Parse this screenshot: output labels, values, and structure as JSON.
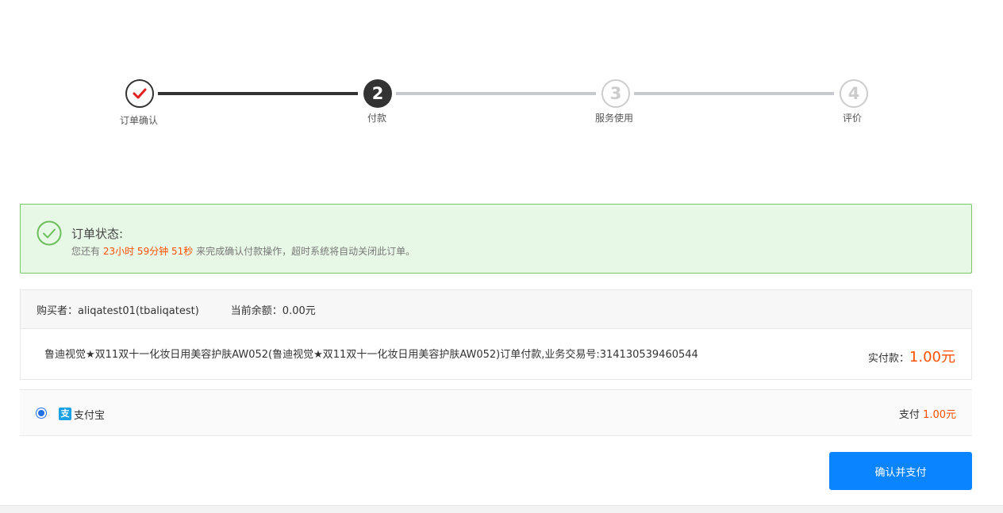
{
  "steps": {
    "items": [
      {
        "number": "",
        "label": "订单确认",
        "state": "done"
      },
      {
        "number": "2",
        "label": "付款",
        "state": "current"
      },
      {
        "number": "3",
        "label": "服务使用",
        "state": "pending"
      },
      {
        "number": "4",
        "label": "评价",
        "state": "pending"
      }
    ]
  },
  "status": {
    "title": "订单状态:",
    "msg_prefix": "您还有",
    "countdown": "23小时 59分钟 51秒",
    "msg_suffix": "来完成确认付款操作，超时系统将自动关闭此订单。",
    "icon": "check-circle-icon"
  },
  "order": {
    "buyer": "购买者：aliqatest01(tbaliqatest)",
    "balance": "当前余额：0.00元",
    "description": "鲁迪视觉★双11双十一化妆日用美容护肤AW052(鲁迪视觉★双11双十一化妆日用美容护肤AW052)订单付款,业务交易号:314130539460544",
    "amount_label": "实付款：",
    "amount_value": "1.00元"
  },
  "payment": {
    "method": "支付宝",
    "method_icon_glyph": "支",
    "pay_label": "支付",
    "pay_value": "1.00元"
  },
  "actions": {
    "confirm_label": "确认并支付"
  },
  "colors": {
    "accent": "#0a84ff",
    "price": "#ff5000",
    "success_bg": "#e8f8e6",
    "success_border": "#7ac86b"
  }
}
